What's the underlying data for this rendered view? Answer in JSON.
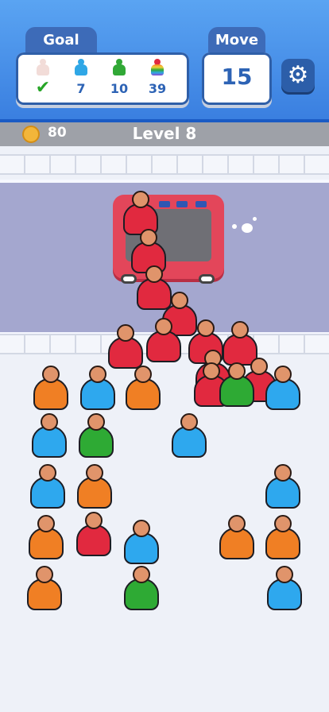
{
  "header": {
    "goal_label": "Goal",
    "move_label": "Move",
    "moves_left": "15",
    "goals": [
      {
        "color": "#f2dcd8",
        "done": true,
        "count": ""
      },
      {
        "color": "#2fa7e6",
        "done": false,
        "count": "7"
      },
      {
        "color": "#31a836",
        "done": false,
        "count": "10"
      },
      {
        "color": "rainbow",
        "done": false,
        "count": "39"
      }
    ],
    "check_glyph": "✔",
    "settings_icon": "gear-icon"
  },
  "status": {
    "coins": "80",
    "level": "Level 8"
  },
  "colors": {
    "red": "#e1293f",
    "blue": "#2ea8ee",
    "green": "#2eaa34",
    "orange": "#f07f24",
    "bus": "#e3465a",
    "road": "#a4a7cf"
  },
  "people": [
    {
      "c": "red"
    },
    {
      "c": "red"
    },
    {
      "c": "red"
    },
    {
      "c": "red"
    },
    {
      "c": "red"
    },
    {
      "c": "red"
    },
    {
      "c": "red"
    },
    {
      "c": "red"
    },
    {
      "c": "red"
    },
    {
      "c": "red"
    },
    {
      "c": "red"
    },
    {
      "c": "green"
    },
    {
      "c": "orange"
    },
    {
      "c": "blue"
    },
    {
      "c": "orange"
    },
    {
      "c": "blue"
    },
    {
      "c": "blue"
    },
    {
      "c": "green"
    },
    {
      "c": "blue"
    },
    {
      "c": "blue"
    },
    {
      "c": "orange"
    },
    {
      "c": "blue"
    },
    {
      "c": "orange"
    },
    {
      "c": "red"
    },
    {
      "c": "blue"
    },
    {
      "c": "orange"
    },
    {
      "c": "orange"
    },
    {
      "c": "orange"
    },
    {
      "c": "green"
    },
    {
      "c": "blue"
    }
  ]
}
